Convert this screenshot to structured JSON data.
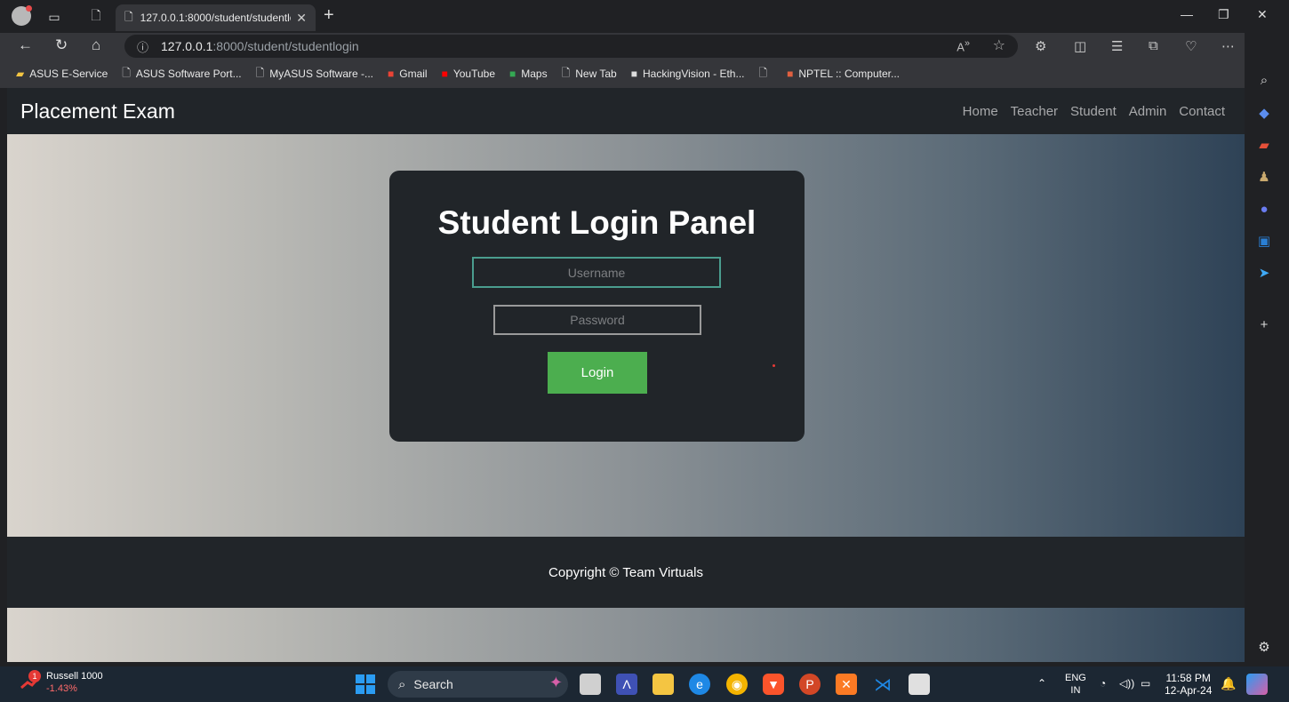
{
  "browser": {
    "tab": {
      "title": "127.0.0.1:8000/student/studentlo",
      "close": "✕"
    },
    "new_tab": "+",
    "window": {
      "minimize": "—",
      "restore": "❐",
      "close": "✕"
    },
    "address": {
      "host": "127.0.0.1",
      "rest": ":8000/student/studentlogin"
    },
    "bookmarks": [
      {
        "label": "ASUS E-Service",
        "icon": "folder-icon",
        "color": "#f4c542"
      },
      {
        "label": "ASUS Software Port...",
        "icon": "page-icon",
        "color": "#dddddd"
      },
      {
        "label": "MyASUS Software -...",
        "icon": "page-icon",
        "color": "#dddddd"
      },
      {
        "label": "Gmail",
        "icon": "gmail-icon",
        "color": "#ea4335"
      },
      {
        "label": "YouTube",
        "icon": "youtube-icon",
        "color": "#ff0000"
      },
      {
        "label": "Maps",
        "icon": "maps-icon",
        "color": "#34a853"
      },
      {
        "label": "New Tab",
        "icon": "page-icon",
        "color": "#dddddd"
      },
      {
        "label": "HackingVision - Eth...",
        "icon": "hackingvision-icon",
        "color": "#dddddd"
      },
      {
        "label": "",
        "icon": "page-icon",
        "color": "#dddddd"
      },
      {
        "label": "NPTEL :: Computer...",
        "icon": "nptel-icon",
        "color": "#e06040"
      }
    ]
  },
  "site": {
    "brand": "Placement Exam",
    "nav": [
      "Home",
      "Teacher",
      "Student",
      "Admin",
      "Contact"
    ],
    "panel": {
      "title": "Student Login Panel",
      "username_placeholder": "Username",
      "password_placeholder": "Password",
      "login_label": "Login"
    },
    "footer": "Copyright © Team Virtuals"
  },
  "taskbar": {
    "widget": {
      "name": "Russell 1000",
      "change": "-1.43%",
      "badge": "1"
    },
    "search": "Search",
    "lang": {
      "line1": "ENG",
      "line2": "IN"
    },
    "clock": {
      "time": "11:58 PM",
      "date": "12-Apr-24"
    }
  },
  "colors": {
    "navbar": "#212529",
    "login_button": "#4cae4f",
    "username_border": "#4a9d8e"
  }
}
